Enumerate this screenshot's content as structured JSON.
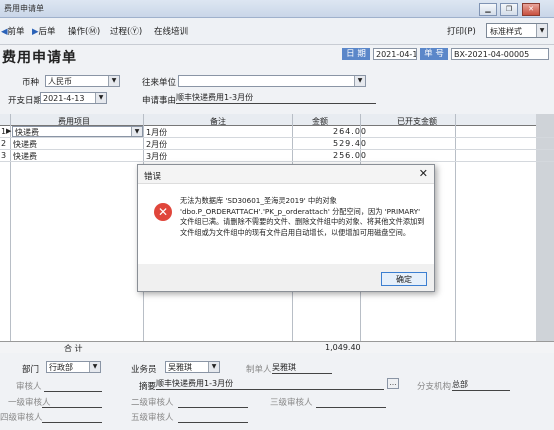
{
  "window": {
    "title": "费用申请单"
  },
  "menu": {
    "items": [
      "前单",
      "后单",
      "操作(Ⓜ)",
      "过程(Ⓨ)",
      "在线培训"
    ],
    "print_label": "打印(P)",
    "style_select": "标准样式"
  },
  "form": {
    "title": "费用申请单",
    "date_label": "日 期",
    "date_value": "2021-04-13",
    "number_label": "单 号",
    "number_value": "BX-2021-04-00005",
    "currency_label": "币种",
    "currency_value": "人民币",
    "partner_label": "往来单位",
    "partner_value": "",
    "start_date_label": "开支日期",
    "start_date_value": "2021-4-13",
    "reason_label": "申请事由",
    "reason_value": "顺丰快递费用1-3月份"
  },
  "grid": {
    "headers": [
      "费用项目",
      "备注",
      "金额",
      "已开支金额"
    ],
    "rows": [
      {
        "num": "1",
        "item": "快递费",
        "note": "1月份",
        "amount": "264.00"
      },
      {
        "num": "2",
        "item": "快递费",
        "note": "2月份",
        "amount": "529.40"
      },
      {
        "num": "3",
        "item": "快递费",
        "note": "3月份",
        "amount": "256.00"
      }
    ],
    "total_label": "合 计",
    "total_value": "1,049.40"
  },
  "footer": {
    "department_label": "部门",
    "department_value": "行政部",
    "salesman_label": "业务员",
    "salesman_value": "吴雅琪",
    "maker_label": "制单人",
    "maker_value": "吴雅琪",
    "reviewer_label": "审核人",
    "summary_label": "摘要",
    "summary_value": "顺丰快递费用1-3月份",
    "branch_label": "分支机构",
    "branch_value": "总部",
    "level1_label": "一级审核人",
    "level2_label": "二级审核人",
    "level3_label": "三级审核人",
    "level4_label": "四级审核人",
    "level5_label": "五级审核人"
  },
  "dialog": {
    "title": "错误",
    "message": "无法为数据库 'SD30601_圣海灵2019' 中的对象 'dbo.P_ORDERATTACH'.'PK_p_orderattach' 分配空间，因为 'PRIMARY' 文件组已满。请删除不需要的文件、删除文件组中的对象、将其他文件添加到文件组或为文件组中的现有文件启用自动增长，以便增加可用磁盘空间。",
    "ok_label": "确定"
  },
  "colors": {
    "accent": "#5b87c9",
    "error": "#e0463b"
  }
}
